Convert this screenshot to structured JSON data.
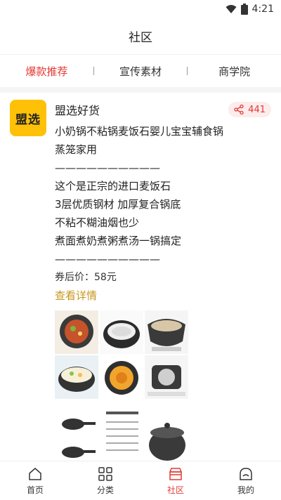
{
  "status": {
    "time": "4:21"
  },
  "header": {
    "title": "社区"
  },
  "tabs": [
    {
      "label": "爆款推荐",
      "active": true
    },
    {
      "label": "宣传素材",
      "active": false
    },
    {
      "label": "商学院",
      "active": false
    }
  ],
  "post": {
    "avatar_text": "盟选",
    "author": "盟选好货",
    "share_count": "441",
    "lines": [
      "小奶锅不粘锅麦饭石婴儿宝宝辅食锅",
      "蒸笼家用",
      "——————————",
      "这个是正宗的进口麦饭石",
      "3层优质钢材 加厚复合锅底",
      "不粘不糊油烟也少",
      "煮面煮奶煮粥煮汤一锅搞定",
      "——————————"
    ],
    "price": "券后价：58元",
    "detail_link": "查看详情"
  },
  "tabbar": [
    {
      "label": "首页",
      "icon": "home-icon",
      "active": false
    },
    {
      "label": "分类",
      "icon": "category-icon",
      "active": false
    },
    {
      "label": "社区",
      "icon": "community-icon",
      "active": true
    },
    {
      "label": "我的",
      "icon": "profile-icon",
      "active": false
    }
  ],
  "colors": {
    "accent": "#e53935",
    "link": "#c8961e",
    "avatar_bg": "#ffc107"
  }
}
